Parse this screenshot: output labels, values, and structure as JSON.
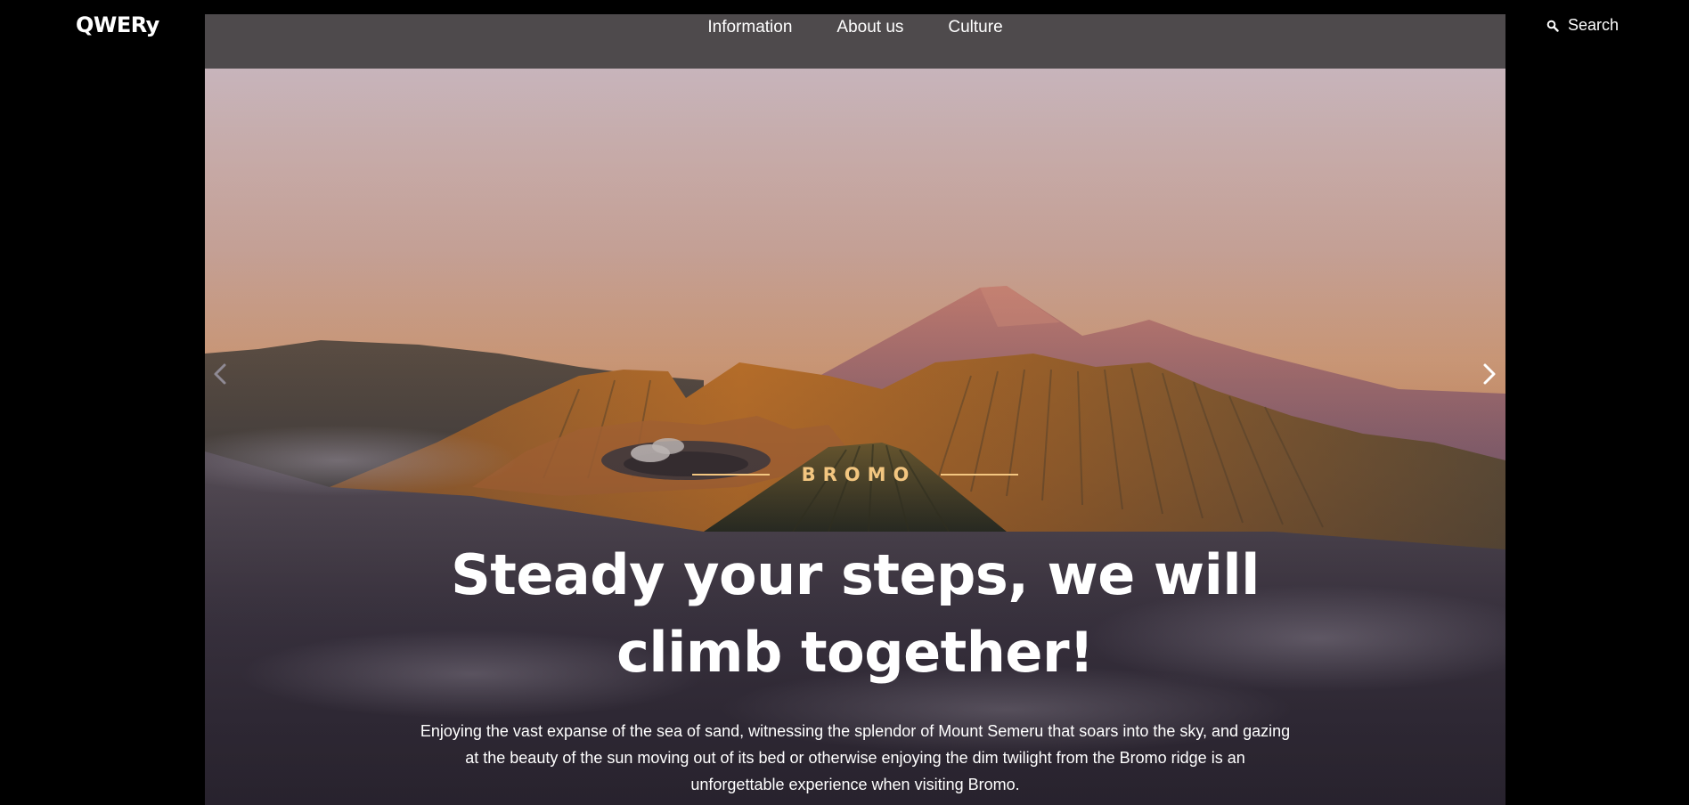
{
  "header": {
    "logo": "QWERy",
    "search_label": "Search",
    "search_icon": "search-icon"
  },
  "nav": {
    "items": [
      {
        "label": "Information"
      },
      {
        "label": "About us"
      },
      {
        "label": "Culture"
      }
    ]
  },
  "hero": {
    "eyebrow": "BROMO",
    "headline_line1": "Steady your steps, we will",
    "headline_line2": "climb together!",
    "description": "Enjoying the vast expanse of the sea of sand, witnessing the splendor of Mount Semeru that soars into the sky, and gazing at the beauty of the sun moving out of its bed or otherwise enjoying the dim twilight from the Bromo ridge is an unforgettable experience when visiting Bromo.",
    "prev_icon": "chevron-left-icon",
    "next_icon": "chevron-right-icon"
  },
  "colors": {
    "page_background": "#000000",
    "nav_background": "#4e4a4c",
    "accent": "#f3c680",
    "text": "#ffffff"
  }
}
